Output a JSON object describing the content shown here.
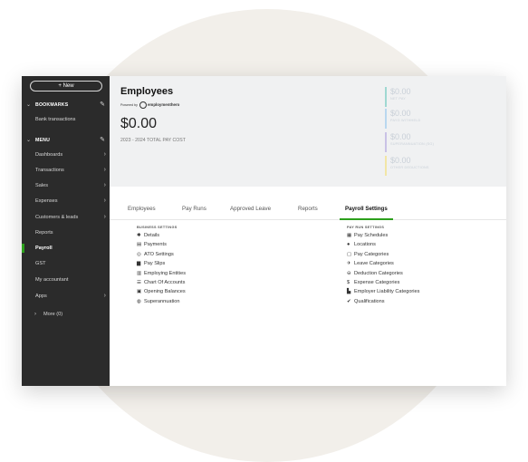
{
  "sidebar": {
    "new_label": "+ New",
    "bookmarks": "BOOKMARKS",
    "bank_transactions": "Bank transactions",
    "menu": "MENU",
    "items": [
      {
        "label": "Dashboards",
        "chevron": true
      },
      {
        "label": "Transactions",
        "chevron": true
      },
      {
        "label": "Sales",
        "chevron": true
      },
      {
        "label": "Expenses",
        "chevron": true
      },
      {
        "label": "Customers & leads",
        "chevron": true
      },
      {
        "label": "Reports",
        "chevron": false
      },
      {
        "label": "Payroll",
        "chevron": false,
        "active": true
      },
      {
        "label": "GST",
        "chevron": false
      },
      {
        "label": "My accountant",
        "chevron": false
      },
      {
        "label": "Apps",
        "chevron": true
      }
    ],
    "more": "More (0)"
  },
  "header": {
    "title": "Employees",
    "powered_by": "Powered by",
    "powered_brand": "employmenthero",
    "total_amount": "$0.00",
    "total_label": "2023 - 2024 TOTAL PAY COST",
    "stats": [
      {
        "amount": "$0.00",
        "label": "NET PAY",
        "color": "#9fd8d2"
      },
      {
        "amount": "$0.00",
        "label": "PAYG WITHHELD",
        "color": "#b9d7ef"
      },
      {
        "amount": "$0.00",
        "label": "SUPERANNUATION (SG)",
        "color": "#c9c2e6"
      },
      {
        "amount": "$0.00",
        "label": "OTHER DEDUCTIONS",
        "color": "#f2e6a6"
      }
    ]
  },
  "tabs": [
    "Employees",
    "Pay Runs",
    "Approved Leave",
    "Reports",
    "Payroll Settings"
  ],
  "business_settings": {
    "heading": "BUSINESS SETTINGS",
    "items": [
      {
        "label": "Details",
        "icon": "gear-icon",
        "glyph": "✱"
      },
      {
        "label": "Payments",
        "icon": "calculator-icon",
        "glyph": "▤"
      },
      {
        "label": "ATO Settings",
        "icon": "ato-icon",
        "glyph": "◎"
      },
      {
        "label": "Pay Slips",
        "icon": "document-icon",
        "glyph": "▆"
      },
      {
        "label": "Employing Entities",
        "icon": "bank-icon",
        "glyph": "▥"
      },
      {
        "label": "Chart Of Accounts",
        "icon": "list-icon",
        "glyph": "☰"
      },
      {
        "label": "Opening Balances",
        "icon": "ledger-icon",
        "glyph": "▣"
      },
      {
        "label": "Superannuation",
        "icon": "super-icon",
        "glyph": "◍"
      }
    ]
  },
  "pay_run_settings": {
    "heading": "PAY RUN SETTINGS",
    "items": [
      {
        "label": "Pay Schedules",
        "icon": "calendar-icon",
        "glyph": "▦"
      },
      {
        "label": "Locations",
        "icon": "globe-icon",
        "glyph": "●"
      },
      {
        "label": "Pay Categories",
        "icon": "money-icon",
        "glyph": "▢"
      },
      {
        "label": "Leave Categories",
        "icon": "plane-icon",
        "glyph": "✈"
      },
      {
        "label": "Deduction Categories",
        "icon": "minus-circle-icon",
        "glyph": "⊖"
      },
      {
        "label": "Expense Categories",
        "icon": "dollar-icon",
        "glyph": "$"
      },
      {
        "label": "Employer Liability Categories",
        "icon": "industry-icon",
        "glyph": "▙"
      },
      {
        "label": "Qualifications",
        "icon": "check-icon",
        "glyph": "✔"
      }
    ]
  },
  "colors": {
    "accent": "#2ca01c",
    "sidebar": "#2b2b2b"
  }
}
